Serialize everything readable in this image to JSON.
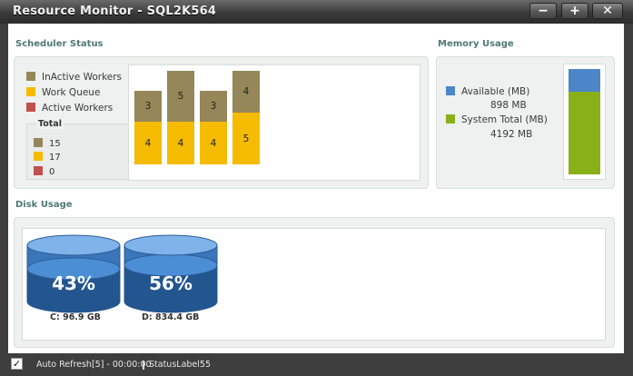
{
  "window": {
    "title": "Resource Monitor - SQL2K564",
    "minimize": "−",
    "maximize": "+",
    "close": "✕"
  },
  "scheduler": {
    "title": "Scheduler Status",
    "legend": [
      {
        "label": "InActive Workers",
        "color": "#958758"
      },
      {
        "label": "Work Queue",
        "color": "#f5bb00"
      },
      {
        "label": "Active Workers",
        "color": "#c0504d"
      }
    ],
    "total_label": "Total",
    "totals": [
      "15",
      "17",
      "0"
    ],
    "bars": [
      {
        "inactive": "3",
        "queue": "4"
      },
      {
        "inactive": "5",
        "queue": "4"
      },
      {
        "inactive": "3",
        "queue": "4"
      },
      {
        "inactive": "4",
        "queue": "5"
      }
    ]
  },
  "memory": {
    "title": "Memory Usage",
    "available_label": "Available (MB)",
    "available_value": "898 MB",
    "system_label": "System Total (MB)",
    "system_value": "4192 MB",
    "available_color": "#4a86c8",
    "system_color": "#8ab019",
    "available_fraction": 0.214
  },
  "disk": {
    "title": "Disk Usage",
    "drives": [
      {
        "percent": "43%",
        "label": "C: 96.9 GB"
      },
      {
        "percent": "56%",
        "label": "D: 834.4 GB"
      }
    ]
  },
  "status": {
    "checked": "✓",
    "auto_refresh": "Auto Refresh[5] - 00:00:00",
    "label": "StatusLabel55"
  }
}
